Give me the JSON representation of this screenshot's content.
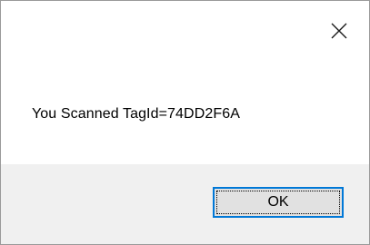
{
  "dialog": {
    "message": "You Scanned TagId=74DD2F6A",
    "ok_label": "OK",
    "close_icon": "close-icon",
    "colors": {
      "background": "#ffffff",
      "footer": "#f0f0f0",
      "button_face": "#e1e1e1",
      "focus_border": "#0078d7",
      "border": "#9a9a9a"
    }
  }
}
